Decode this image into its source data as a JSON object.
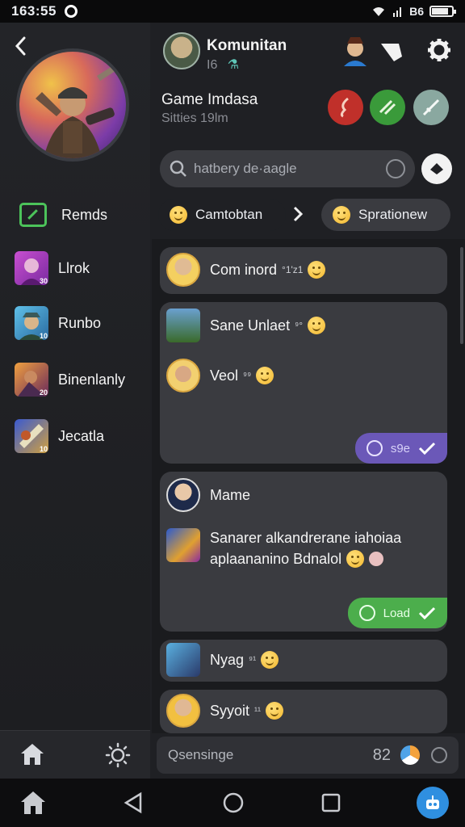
{
  "status_bar": {
    "time": "163:55",
    "battery_text": "B6",
    "battery_level": 0.85
  },
  "sidebar": {
    "back_icon": "chevron-left-icon",
    "items": [
      {
        "label": "Remds",
        "icon": "edit-square-icon"
      },
      {
        "label": "Llrok",
        "corner": "30"
      },
      {
        "label": "Runbo",
        "corner": "10"
      },
      {
        "label": "Binenlanly",
        "corner": "20"
      },
      {
        "label": "Jecatla",
        "corner": "10"
      }
    ]
  },
  "header": {
    "title": "Komunitan",
    "subtitle": "I6",
    "subtitle_icon": "flask-icon"
  },
  "group": {
    "title": "Game Imdasa",
    "subtitle": "Sitties 19lm",
    "buttons": [
      {
        "icon": "music-note-icon",
        "color": "#c0302a"
      },
      {
        "icon": "controller-icon",
        "color": "#3a9a3a"
      },
      {
        "icon": "sword-icon",
        "color": "#8aa8a0"
      }
    ]
  },
  "search": {
    "placeholder": "hatbery de·aagle"
  },
  "filters": {
    "left_label": "Camtobtan",
    "right_label": "Sprationew"
  },
  "feed": {
    "items": [
      {
        "text": "Com inord",
        "suffix": "°1'z1"
      },
      {
        "text": "Sane Unlaet",
        "suffix": "⁹°"
      },
      {
        "text": "Veol",
        "suffix": "⁹⁹"
      },
      {
        "badge": "s9e"
      },
      {
        "text": "Mame"
      },
      {
        "text": "Sanarer alkandrerane iahoiaa",
        "text2": "aplaananino Bdnalol"
      },
      {
        "badge": "Load"
      },
      {
        "text": "Nyag",
        "suffix": "⁹¹"
      },
      {
        "text": "Syyoit",
        "suffix": "¹¹"
      }
    ]
  },
  "input": {
    "placeholder": "Qsensinge",
    "count": "82"
  },
  "colors": {
    "accent_green": "#4cc35a",
    "badge_purple": "#6b58b8",
    "badge_green": "#4cae4c",
    "nav_blue": "#2f8fe0"
  }
}
